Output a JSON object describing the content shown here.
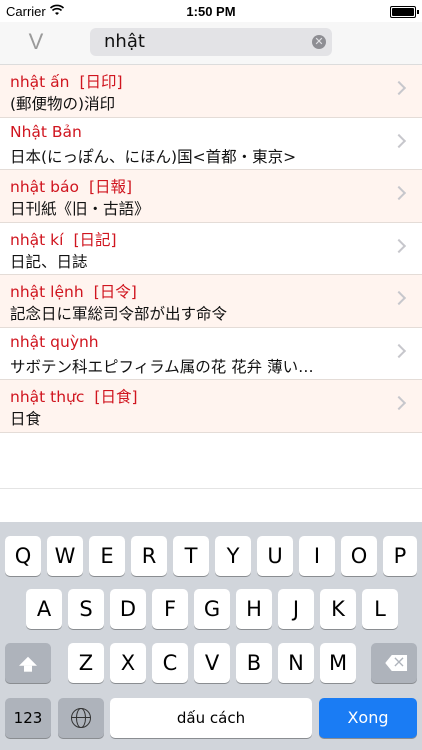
{
  "status_bar": {
    "carrier": "Carrier",
    "time": "1:50 PM"
  },
  "search": {
    "back_label": "V",
    "value": "nhật",
    "clear_icon": "clear-icon"
  },
  "results": [
    {
      "word": "nhật ấn",
      "kanji": "[日印]",
      "meaning": "(郵便物の)消印"
    },
    {
      "word": "Nhật Bản",
      "kanji": "",
      "meaning": "日本(にっぽん、にほん)国<首都・東京>"
    },
    {
      "word": "nhật báo",
      "kanji": "[日報]",
      "meaning": "日刊紙《旧・古語》"
    },
    {
      "word": "nhật kí",
      "kanji": "[日記]",
      "meaning": "日記、日誌"
    },
    {
      "word": "nhật lệnh",
      "kanji": "[日令]",
      "meaning": "記念日に軍総司令部が出す命令"
    },
    {
      "word": "nhật quỳnh",
      "kanji": "",
      "meaning": "サボテン科エピフィラム属の花 花弁 薄い…"
    },
    {
      "word": "nhật thực",
      "kanji": "[日食]",
      "meaning": "日食"
    }
  ],
  "keyboard": {
    "row1": [
      "Q",
      "W",
      "E",
      "R",
      "T",
      "Y",
      "U",
      "I",
      "O",
      "P"
    ],
    "row2": [
      "A",
      "S",
      "D",
      "F",
      "G",
      "H",
      "J",
      "K",
      "L"
    ],
    "row3": [
      "Z",
      "X",
      "C",
      "V",
      "B",
      "N",
      "M"
    ],
    "numbers_label": "123",
    "space_label": "dấu cách",
    "done_label": "Xong"
  },
  "colors": {
    "accent_red": "#d0151f",
    "done_blue": "#1a7cf4",
    "row_tint": "#fff4ef"
  }
}
